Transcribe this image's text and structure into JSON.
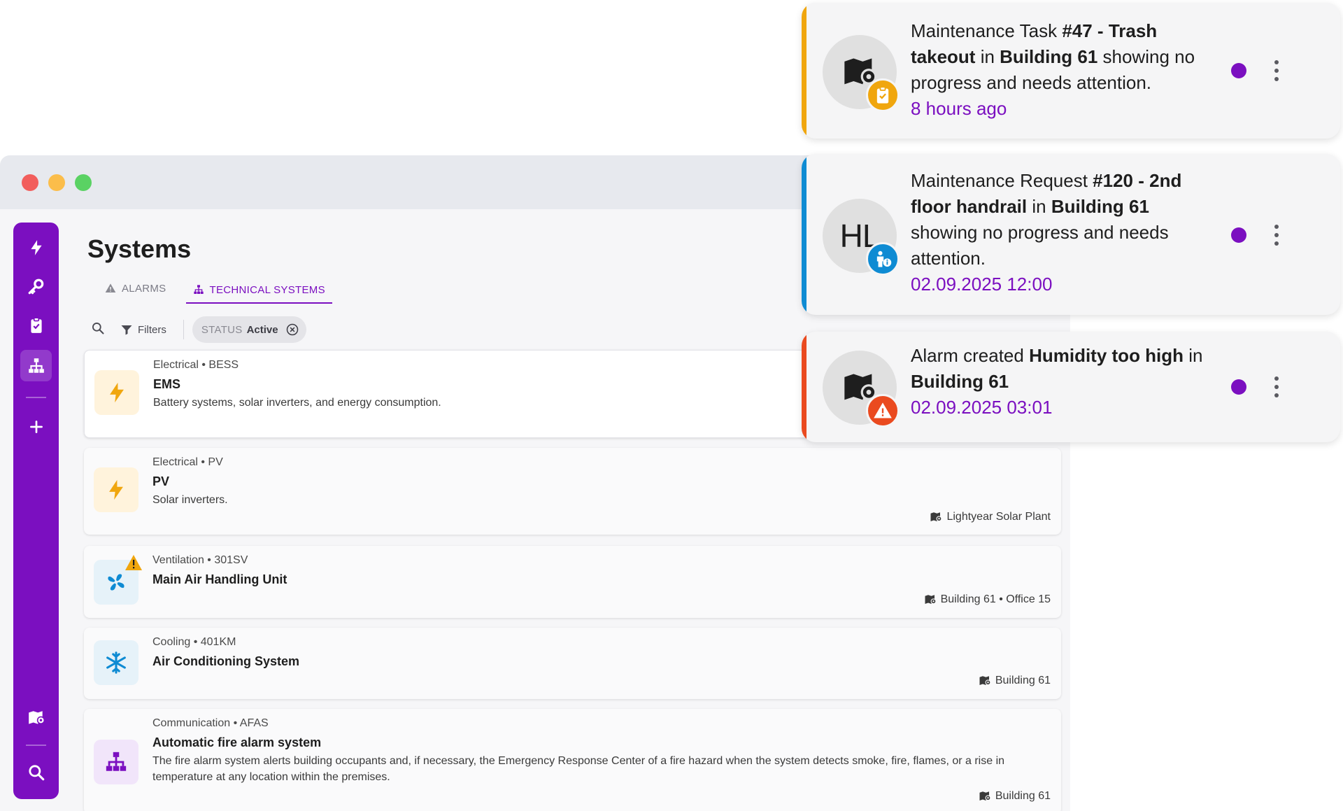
{
  "colors": {
    "brand": "#7b0fc0",
    "task_bar": "#f0a60e",
    "request_bar": "#0e8bd3",
    "alarm_bar": "#ea4a1f"
  },
  "page": {
    "title": "Systems"
  },
  "tabs": [
    {
      "label": "ALARMS",
      "icon": "warning-icon"
    },
    {
      "label": "TECHNICAL SYSTEMS",
      "icon": "network-icon"
    }
  ],
  "toolbar": {
    "filters_label": "Filters",
    "chip_key": "STATUS",
    "chip_value": "Active"
  },
  "sidebar": {
    "items": [
      "bolt-icon",
      "key-icon",
      "clipboard-icon",
      "network-icon",
      "plus-icon",
      "map-pin-icon",
      "search-icon"
    ]
  },
  "systems": [
    {
      "category": "Electrical • BESS",
      "name": "EMS",
      "description": "Battery systems, solar inverters, and energy consumption.",
      "icon": "bolt-icon",
      "location": ""
    },
    {
      "category": "Electrical • PV",
      "name": "PV",
      "description": "Solar inverters.",
      "icon": "bolt-icon",
      "location": "Lightyear Solar Plant"
    },
    {
      "category": "Ventilation • 301SV",
      "name": "Main Air Handling Unit",
      "description": "",
      "icon": "fan-icon",
      "location": "Building 61 • Office 15"
    },
    {
      "category": "Cooling • 401KM",
      "name": "Air Conditioning System",
      "description": "",
      "icon": "snowflake-icon",
      "location": "Building 61"
    },
    {
      "category": "Communication • AFAS",
      "name": "Automatic fire alarm system",
      "description": "The fire alarm system alerts building occupants and, if necessary, the Emergency Response Center of a fire hazard when the system detects smoke, fire, flames, or a rise in temperature at any location within the premises.",
      "icon": "network-icon",
      "location": "Building 61"
    }
  ],
  "notifications": [
    {
      "t1": "Maintenance Task ",
      "b1": "#47 - Trash takeout",
      "t2": " in ",
      "b2": "Building 61",
      "t3": " showing no progress and needs attention.",
      "time": "8 hours ago",
      "avatar_icon": "map-pin-icon",
      "badge_icon": "clipboard-icon"
    },
    {
      "t1": "Maintenance Request ",
      "b1": "#120 - 2nd floor handrail",
      "t2": " in ",
      "b2": "Building 61",
      "t3": " showing no progress and needs attention.",
      "time": "02.09.2025 12:00",
      "avatar_initials": "HL",
      "badge_icon": "person-info-icon"
    },
    {
      "t1": "Alarm created ",
      "b1": "Humidity too high",
      "t2": " in ",
      "b2": "Building 61",
      "t3": "",
      "time": "02.09.2025 03:01",
      "avatar_icon": "map-pin-icon",
      "badge_icon": "warning-icon"
    }
  ]
}
